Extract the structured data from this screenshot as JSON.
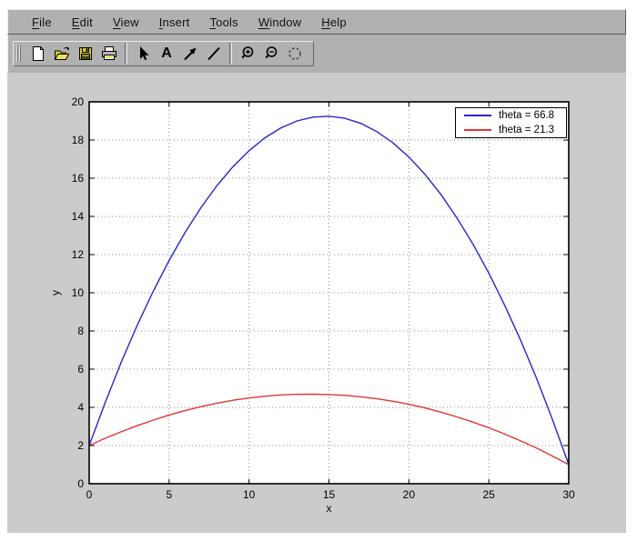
{
  "window": {
    "chrome_color": "#b1b1b1",
    "canvas_color": "#cbcbcb"
  },
  "menu": {
    "items": [
      {
        "label": "File",
        "mnemonic": "F",
        "rest": "ile"
      },
      {
        "label": "Edit",
        "mnemonic": "E",
        "rest": "dit"
      },
      {
        "label": "View",
        "mnemonic": "V",
        "rest": "iew"
      },
      {
        "label": "Insert",
        "mnemonic": "I",
        "rest": "nsert"
      },
      {
        "label": "Tools",
        "mnemonic": "T",
        "rest": "ools"
      },
      {
        "label": "Window",
        "mnemonic": "W",
        "rest": "indow"
      },
      {
        "label": "Help",
        "mnemonic": "H",
        "rest": "elp"
      }
    ]
  },
  "toolbar": {
    "buttons": [
      {
        "name": "new-figure",
        "icon": "new-document-icon"
      },
      {
        "name": "open-file",
        "icon": "open-folder-icon"
      },
      {
        "name": "save-figure",
        "icon": "save-floppy-icon"
      },
      {
        "name": "print-figure",
        "icon": "print-icon"
      },
      {
        "name": "pointer-tool",
        "icon": "pointer-arrow-icon"
      },
      {
        "name": "text-tool",
        "icon": "text-a-icon",
        "glyph": "A"
      },
      {
        "name": "arrow-tool",
        "icon": "arrow-ne-icon"
      },
      {
        "name": "line-tool",
        "icon": "line-icon"
      },
      {
        "name": "zoom-in-tool",
        "icon": "zoom-in-icon"
      },
      {
        "name": "zoom-out-tool",
        "icon": "zoom-out-icon"
      },
      {
        "name": "rotate-tool",
        "icon": "rotate-3d-icon"
      }
    ]
  },
  "chart_data": {
    "type": "line",
    "title": "",
    "xlabel": "x",
    "ylabel": "y",
    "xlim": [
      0,
      30
    ],
    "ylim": [
      0,
      20
    ],
    "x_ticks": [
      0,
      5,
      10,
      15,
      20,
      25,
      30
    ],
    "y_ticks": [
      0,
      2,
      4,
      6,
      8,
      10,
      12,
      14,
      16,
      18,
      20
    ],
    "grid": true,
    "grid_style": "dotted",
    "legend_position": "top-right",
    "series": [
      {
        "name": "theta = 66.8",
        "color": "#2626cc",
        "x": [
          0,
          1,
          2,
          3,
          4,
          5,
          6,
          7,
          8,
          9,
          10,
          11,
          12,
          13,
          14,
          15,
          16,
          17,
          18,
          19,
          20,
          21,
          22,
          23,
          24,
          25,
          26,
          27,
          28,
          29,
          30
        ],
        "y": [
          2,
          4.25,
          6.35,
          8.29,
          10.07,
          11.69,
          13.16,
          14.47,
          15.62,
          16.61,
          17.44,
          18.12,
          18.64,
          19.0,
          19.2,
          19.25,
          19.14,
          18.87,
          18.44,
          17.85,
          17.11,
          16.21,
          15.15,
          13.93,
          12.56,
          11.03,
          9.34,
          7.49,
          5.49,
          3.32,
          1.0
        ]
      },
      {
        "name": "theta = 21.3",
        "color": "#e33434",
        "x": [
          0,
          1,
          2,
          3,
          4,
          5,
          6,
          7,
          8,
          9,
          10,
          11,
          12,
          13,
          14,
          15,
          16,
          17,
          18,
          19,
          20,
          21,
          22,
          23,
          24,
          25,
          26,
          27,
          28,
          29,
          30
        ],
        "y": [
          2,
          2.38,
          2.72,
          3.04,
          3.33,
          3.6,
          3.83,
          4.04,
          4.22,
          4.37,
          4.49,
          4.58,
          4.65,
          4.68,
          4.69,
          4.67,
          4.63,
          4.55,
          4.45,
          4.32,
          4.16,
          3.97,
          3.75,
          3.5,
          3.23,
          2.93,
          2.6,
          2.24,
          1.86,
          1.44,
          1.0
        ]
      }
    ]
  }
}
